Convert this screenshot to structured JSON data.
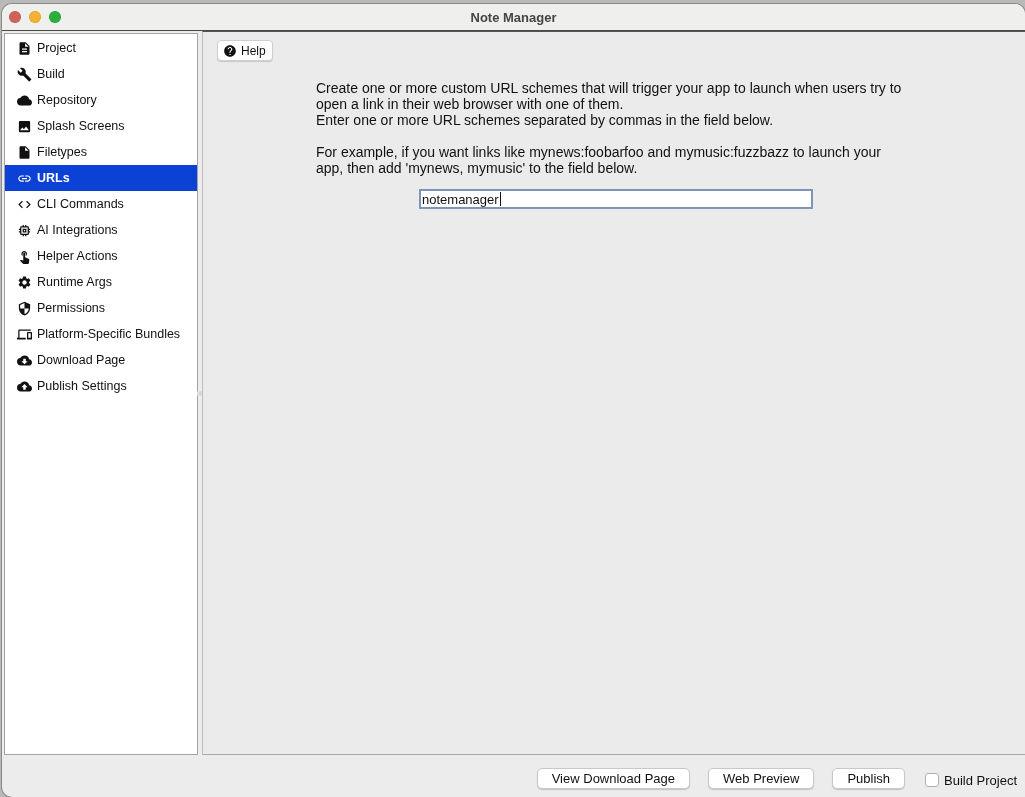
{
  "window": {
    "title": "Note Manager"
  },
  "sidebar": {
    "items": [
      {
        "label": "Project",
        "selected": false
      },
      {
        "label": "Build",
        "selected": false
      },
      {
        "label": "Repository",
        "selected": false
      },
      {
        "label": "Splash Screens",
        "selected": false
      },
      {
        "label": "Filetypes",
        "selected": false
      },
      {
        "label": "URLs",
        "selected": true
      },
      {
        "label": "CLI Commands",
        "selected": false
      },
      {
        "label": "AI Integrations",
        "selected": false
      },
      {
        "label": "Helper Actions",
        "selected": false
      },
      {
        "label": "Runtime Args",
        "selected": false
      },
      {
        "label": "Permissions",
        "selected": false
      },
      {
        "label": "Platform-Specific Bundles",
        "selected": false
      },
      {
        "label": "Download Page",
        "selected": false
      },
      {
        "label": "Publish Settings",
        "selected": false
      }
    ]
  },
  "help_button": {
    "label": "Help"
  },
  "description": {
    "paragraphs": [
      [
        "Create one or more custom URL schemes that will trigger your app to launch when users try to open a link in their web browser with one of them.",
        "Enter one or more URL schemes separated by commas in the field below."
      ],
      [
        "For example, if you want links like mynews:foobarfoo and mymusic:fuzzbazz to launch your app, then add 'mynews, mymusic' to the field below."
      ]
    ]
  },
  "url_schemes_field": {
    "value": "notemanager",
    "focused": true
  },
  "footer": {
    "buttons": [
      "View Download Page",
      "Web Preview",
      "Publish"
    ],
    "build_project": {
      "label": "Build Project",
      "checked": false
    }
  }
}
